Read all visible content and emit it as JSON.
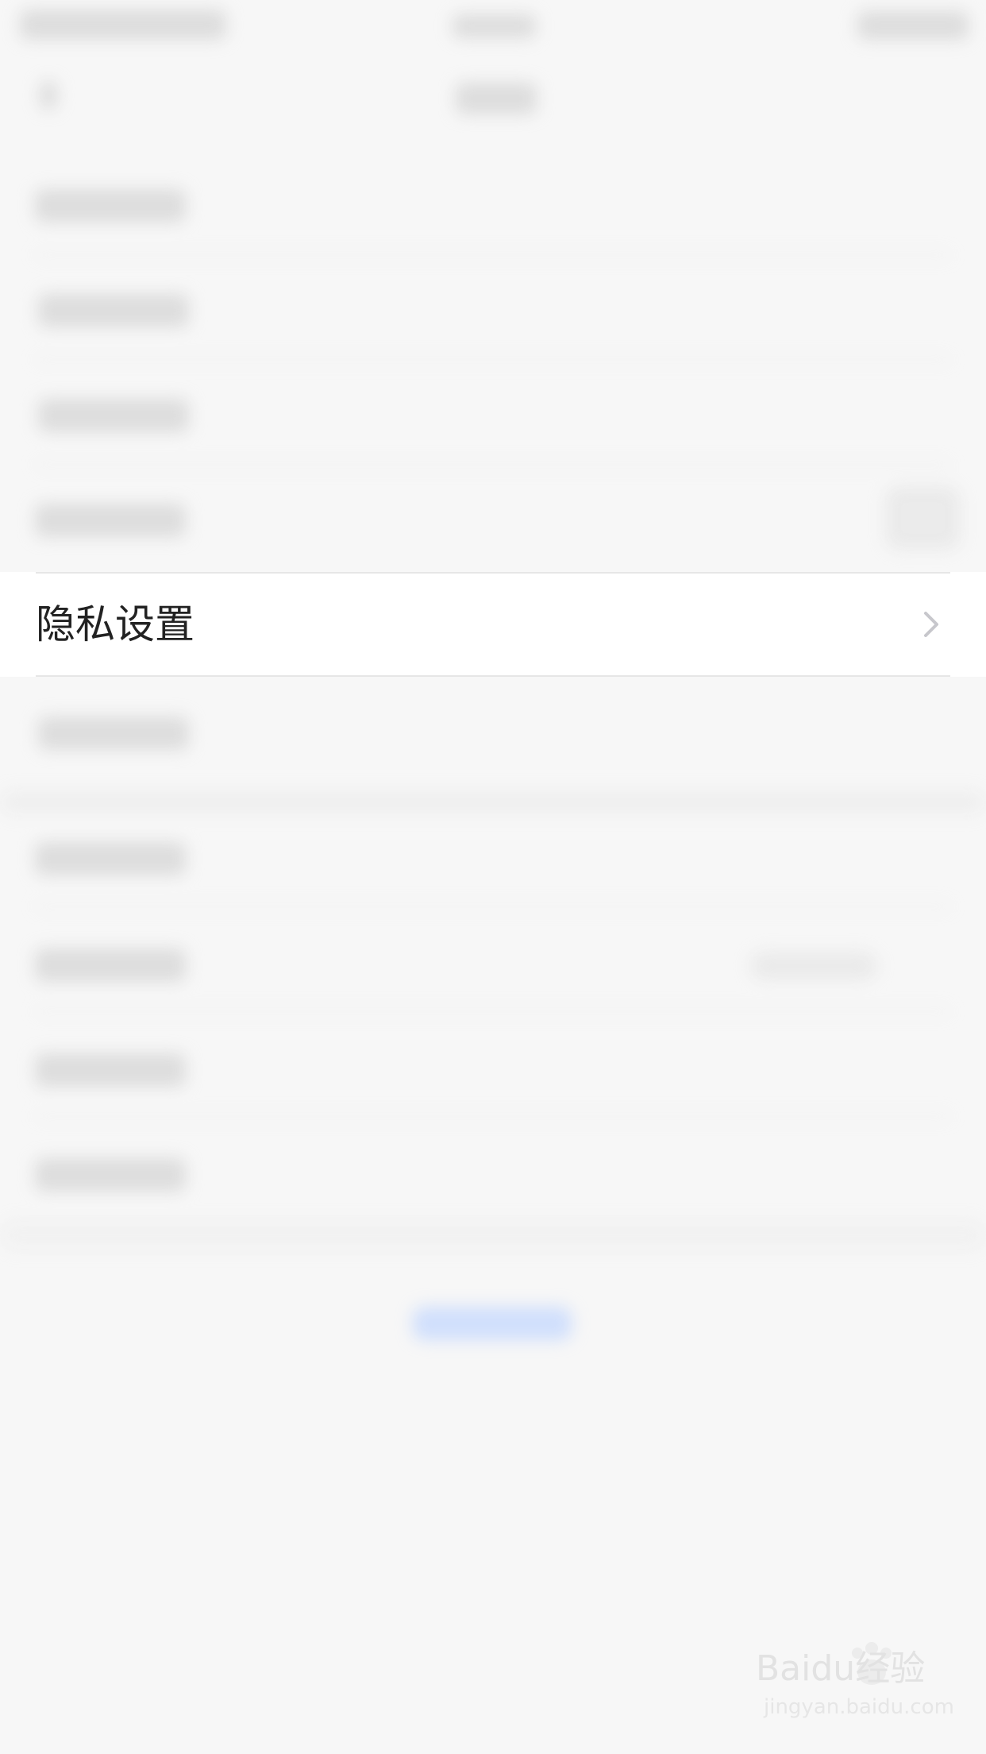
{
  "privacy_row": {
    "label": "隐私设置"
  },
  "watermark": {
    "main_text": "Baidu经验",
    "sub_text": "jingyan.baidu.com"
  },
  "icons": {
    "chevron": "chevron-right-icon",
    "watermark_paw": "paw-icon"
  },
  "colors": {
    "background": "#f7f7f7",
    "row_background": "#ffffff",
    "text_primary": "#222222",
    "divider": "#e6e6e6",
    "chevron": "#c7c7cc",
    "blur_gray": "#cfcfcf",
    "blur_blue": "#bcd3ff"
  }
}
